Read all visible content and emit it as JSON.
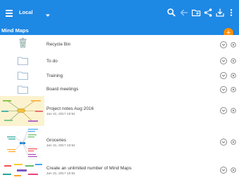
{
  "toolbar": {
    "storage_location": "Local",
    "icons": [
      "menu-icon",
      "dropdown-arrow-icon",
      "search-icon",
      "back-icon",
      "new-folder-icon",
      "share-icon",
      "download-icon",
      "more-vert-icon"
    ]
  },
  "breadcrumb": "Mind Maps",
  "fab": {
    "label": "+",
    "color": "#ff8f00"
  },
  "colors": {
    "primary": "#1e88e5",
    "accent": "#ff8f00"
  },
  "items": [
    {
      "title": "Recycle Bin",
      "date": "",
      "type": "recycle-bin"
    },
    {
      "title": "To do",
      "date": "",
      "type": "folder"
    },
    {
      "title": "Training",
      "date": "",
      "type": "folder"
    },
    {
      "title": "Board meetings",
      "date": "",
      "type": "folder"
    },
    {
      "title": "Project notes Aug 2016",
      "date": "Jan 31, 2017 10:51",
      "type": "map"
    },
    {
      "title": "Groceries",
      "date": "Jan 31, 2017 10:51",
      "type": "map"
    },
    {
      "title": "Create an unlimited number of Mind Maps",
      "date": "Jan 31, 2017 10:51",
      "type": "map"
    }
  ]
}
